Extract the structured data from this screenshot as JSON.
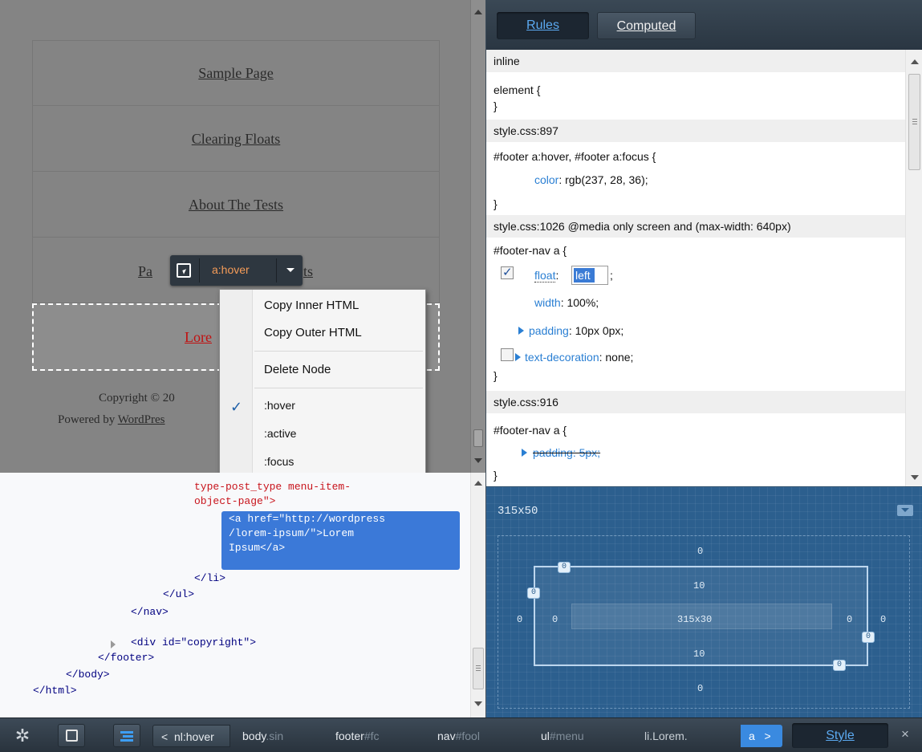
{
  "preview": {
    "nav_items": [
      "Sample Page",
      "Clearing Floats",
      "About The Tests"
    ],
    "nav_partial_left": "Pa",
    "nav_partial_right": "ts",
    "selected_link": "Lore",
    "copyright_line1": "Copyright © 20",
    "copyright_powered": "Powered by ",
    "copyright_wp": "WordPres"
  },
  "infobar": {
    "pseudo_label": "a:hover"
  },
  "context_menu": {
    "copy_inner": "Copy Inner HTML",
    "copy_outer": "Copy Outer HTML",
    "delete_node": "Delete Node",
    "pseudo_hover": ":hover",
    "pseudo_active": ":active",
    "pseudo_focus": ":focus",
    "checked_mark": "✓"
  },
  "markup": {
    "lines": [
      "type-post_type menu-item-",
      "object-page\">",
      "<a href=\"http://wordpress",
      "/lorem-ipsum/\">Lorem",
      "Ipsum</a>",
      "</li>",
      "</ul>",
      "</nav>",
      "<div id=\"copyright\">",
      "</footer>",
      "</body>",
      "</html>"
    ]
  },
  "sidebar": {
    "tabs": {
      "rules": "Rules",
      "computed": "Computed"
    },
    "rules": {
      "inline_hdr": "inline",
      "element_open": "element {",
      "close": "}",
      "src1": "style.css:897",
      "sel1": "#footer a:hover, #footer a:focus {",
      "prop1": "color",
      "val1": ": rgb(237, 28, 36);",
      "src2": "style.css:1026 @media only screen and (max-width: 640px)",
      "sel2": "#footer-nav a {",
      "float_prop": "float",
      "float_colon": ":",
      "float_val": "left",
      "float_semicolon": ";",
      "width_prop": "width",
      "width_val": ": 100%;",
      "padding_prop": "padding",
      "padding_val": ": 10px 0px;",
      "textdec_prop": "text-decoration",
      "textdec_val": ": none;",
      "src3": "style.css:916",
      "sel3": "#footer-nav a {",
      "padding2": "padding: 5px;"
    }
  },
  "layout": {
    "dims": "315x50",
    "margin_top": "0",
    "margin_bottom": "0",
    "margin_left": "0",
    "margin_right": "0",
    "border_left": "0",
    "border_right": "0",
    "padding_top": "10",
    "padding_bottom": "10",
    "content": "315x30",
    "badge_tl": "0",
    "badge_l": "0",
    "badge_r": "0",
    "badge_br": "0"
  },
  "toolbar": {
    "gear": "✲",
    "back": "<",
    "crumbs": [
      {
        "name": "nl:hover",
        "suffix": ""
      },
      {
        "name": "body",
        "suffix": ".sin"
      },
      {
        "name": "footer",
        "suffix": "#fc"
      },
      {
        "name": "nav",
        "suffix": "#fool"
      },
      {
        "name": "ul",
        "suffix": "#menu"
      },
      {
        "name": "li.Lorem.",
        "suffix": ""
      },
      {
        "name": "a",
        "suffix": ""
      }
    ],
    "forward": ">",
    "style_tab": "Style",
    "close": "×"
  }
}
